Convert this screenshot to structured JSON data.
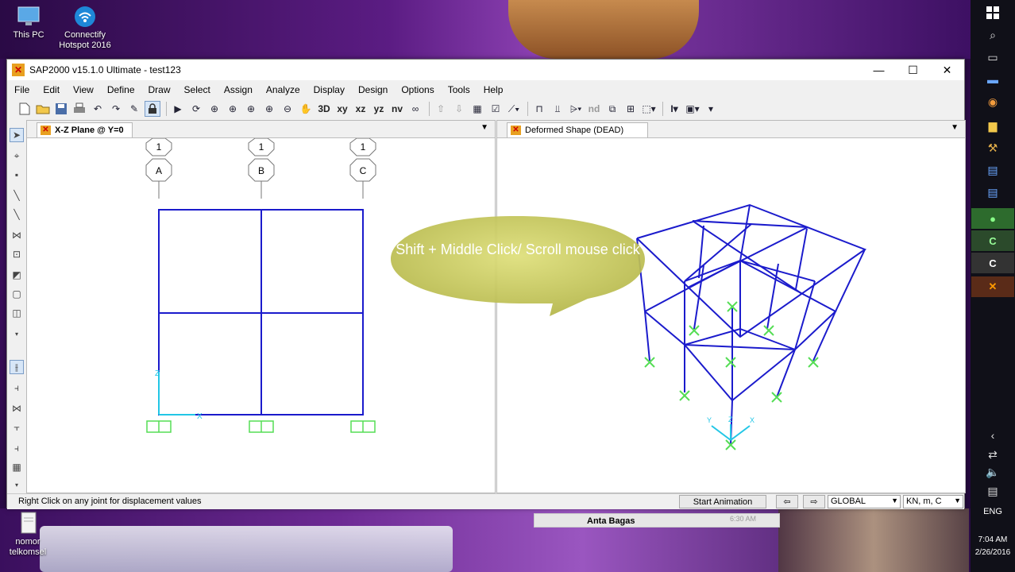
{
  "desktop": {
    "icons": [
      {
        "label": "This PC"
      },
      {
        "label": "Connectify Hotspot 2016"
      },
      {
        "label": "nomor telkomsel"
      }
    ],
    "notification_name": "Anta Bagas",
    "notification_time": "6:30 AM"
  },
  "window": {
    "title": "SAP2000 v15.1.0 Ultimate  - test123",
    "controls": {
      "minimize": "—",
      "maximize": "☐",
      "close": "✕"
    }
  },
  "menu": [
    "File",
    "Edit",
    "View",
    "Define",
    "Draw",
    "Select",
    "Assign",
    "Analyze",
    "Display",
    "Design",
    "Options",
    "Tools",
    "Help"
  ],
  "toolbar": {
    "labels": [
      "3D",
      "xy",
      "xz",
      "yz",
      "nv",
      "nd"
    ]
  },
  "left_pane": {
    "tab_title": "X-Z Plane @ Y=0",
    "grid_bubbles_top": [
      "1",
      "1",
      "1"
    ],
    "grid_bubbles_bottom": [
      "A",
      "B",
      "C"
    ],
    "axis_labels": {
      "x": "X",
      "z": "Z"
    }
  },
  "right_pane": {
    "tab_title": "Deformed Shape (DEAD)",
    "axis_labels": {
      "x": "X",
      "y": "Y",
      "z": "Z"
    }
  },
  "callout": {
    "text": "Shift + Middle Click/ Scroll mouse click"
  },
  "status": {
    "message": "Right Click on any joint for displacement values",
    "animation_button": "Start Animation",
    "prev": "⇦",
    "next": "⇨",
    "coord_system": "GLOBAL",
    "units": "KN, m, C"
  },
  "taskbar": {
    "time": "7:04 AM",
    "date": "2/26/2016",
    "lang": "ENG"
  },
  "colors": {
    "frame": "#1b1bcc",
    "support": "#55dd55",
    "axis": "#22c6e6",
    "callout": "#c7c85a"
  }
}
